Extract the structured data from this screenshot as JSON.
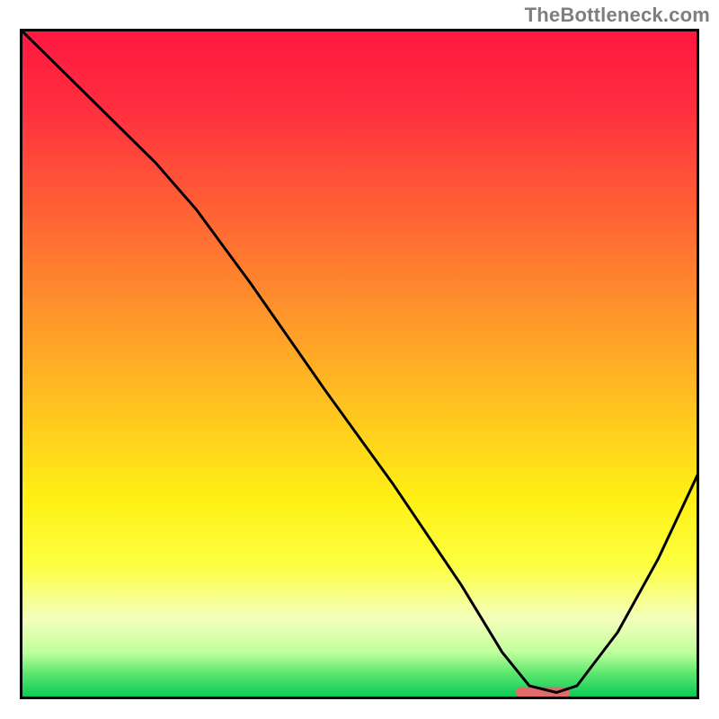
{
  "watermark": "TheBottleneck.com",
  "chart_data": {
    "type": "line",
    "title": "",
    "xlabel": "",
    "ylabel": "",
    "xlim": [
      0,
      100
    ],
    "ylim": [
      0,
      100
    ],
    "grid": false,
    "background_gradient": {
      "stops": [
        {
          "offset": 0,
          "color": "#ff1740"
        },
        {
          "offset": 12,
          "color": "#ff2f3f"
        },
        {
          "offset": 28,
          "color": "#ff6434"
        },
        {
          "offset": 44,
          "color": "#ff9a2a"
        },
        {
          "offset": 58,
          "color": "#ffc81f"
        },
        {
          "offset": 70,
          "color": "#fff014"
        },
        {
          "offset": 80,
          "color": "#fdff40"
        },
        {
          "offset": 88,
          "color": "#f4ffbc"
        },
        {
          "offset": 93,
          "color": "#c0ff9c"
        },
        {
          "offset": 96,
          "color": "#60e870"
        },
        {
          "offset": 100,
          "color": "#00c853"
        }
      ]
    },
    "series": [
      {
        "name": "bottleneck-curve",
        "color": "#000000",
        "x": [
          0,
          10,
          20,
          26,
          34,
          45,
          55,
          65,
          71,
          75,
          79,
          82,
          88,
          94,
          100
        ],
        "y": [
          100,
          90,
          80,
          73,
          62,
          46,
          32,
          17,
          7,
          2,
          1,
          2,
          10,
          21,
          34
        ]
      }
    ],
    "marker": {
      "name": "optimal-range",
      "shape": "pill",
      "color": "#e26a6a",
      "x_start": 73,
      "x_end": 81,
      "y": 1,
      "thickness_pct": 1.6
    },
    "frame_color": "#000000"
  }
}
